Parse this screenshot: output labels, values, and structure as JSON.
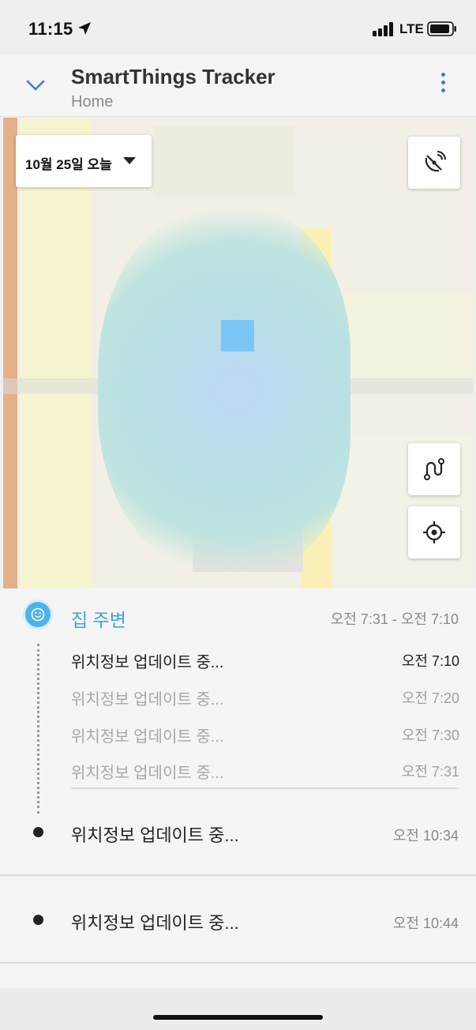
{
  "status_bar": {
    "time": "11:15",
    "network": "LTE"
  },
  "header": {
    "title": "SmartThings Tracker",
    "subtitle": "Home"
  },
  "map": {
    "date_selector": "10월 25일 오늘",
    "buttons": [
      "satellite-icon",
      "route-icon",
      "locate-icon"
    ]
  },
  "history": {
    "group": {
      "title": "집 주변",
      "range": "오전 7:31 - 오전 7:10",
      "entries": [
        {
          "label": "위치정보 업데이트 중...",
          "time": "오전 7:10"
        },
        {
          "label": "위치정보 업데이트 중...",
          "time": "오전 7:20"
        },
        {
          "label": "위치정보 업데이트 중...",
          "time": "오전 7:30"
        },
        {
          "label": "위치정보 업데이트 중...",
          "time": "오전 7:31"
        }
      ]
    },
    "items": [
      {
        "label": "위치정보 업데이트 중...",
        "time": "오전 10:34"
      },
      {
        "label": "위치정보 업데이트 중...",
        "time": "오전 10:44"
      }
    ]
  },
  "colors": {
    "accent": "#3aa3e3",
    "menu_blue": "#3a7fd5"
  }
}
